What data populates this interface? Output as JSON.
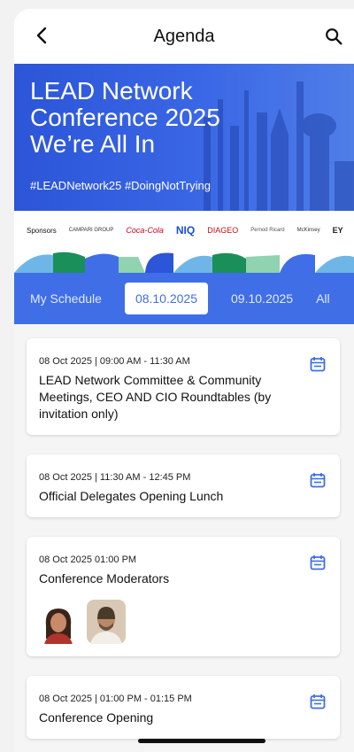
{
  "header": {
    "title": "Agenda"
  },
  "banner": {
    "title_line1": "LEAD Network",
    "title_line2": "Conference 2025",
    "title_line3": "We’re All In",
    "hashtags": "#LEADNetwork25 #DoingNotTrying"
  },
  "sponsors": {
    "label": "Sponsors",
    "items": [
      "CAMPARI GROUP",
      "Coca-Cola",
      "NIQ",
      "DIAGEO",
      "Pernod Ricard",
      "McKinsey",
      "EY"
    ]
  },
  "tabs": [
    {
      "label": "My Schedule",
      "active": false
    },
    {
      "label": "08.10.2025",
      "active": true
    },
    {
      "label": "09.10.2025",
      "active": false
    },
    {
      "label": "All",
      "active": false
    }
  ],
  "sessions": [
    {
      "meta": "08 Oct 2025 | 09:00 AM - 11:30 AM",
      "name": "LEAD Network Committee & Community Meetings, CEO AND CIO Roundtables (by invitation only)"
    },
    {
      "meta": "08 Oct 2025 | 11:30 AM - 12:45 PM",
      "name": "Official Delegates Opening Lunch"
    },
    {
      "meta": "08 Oct 2025 01:00 PM",
      "name": "Conference Moderators"
    },
    {
      "meta": "08 Oct 2025 | 01:00 PM - 01:15 PM",
      "name": "Conference Opening"
    }
  ],
  "colors": {
    "accent": "#3f6ee6",
    "banner": "#2c55d8",
    "deco_green": "#1a8f5a",
    "deco_light": "#8fd3b0"
  }
}
